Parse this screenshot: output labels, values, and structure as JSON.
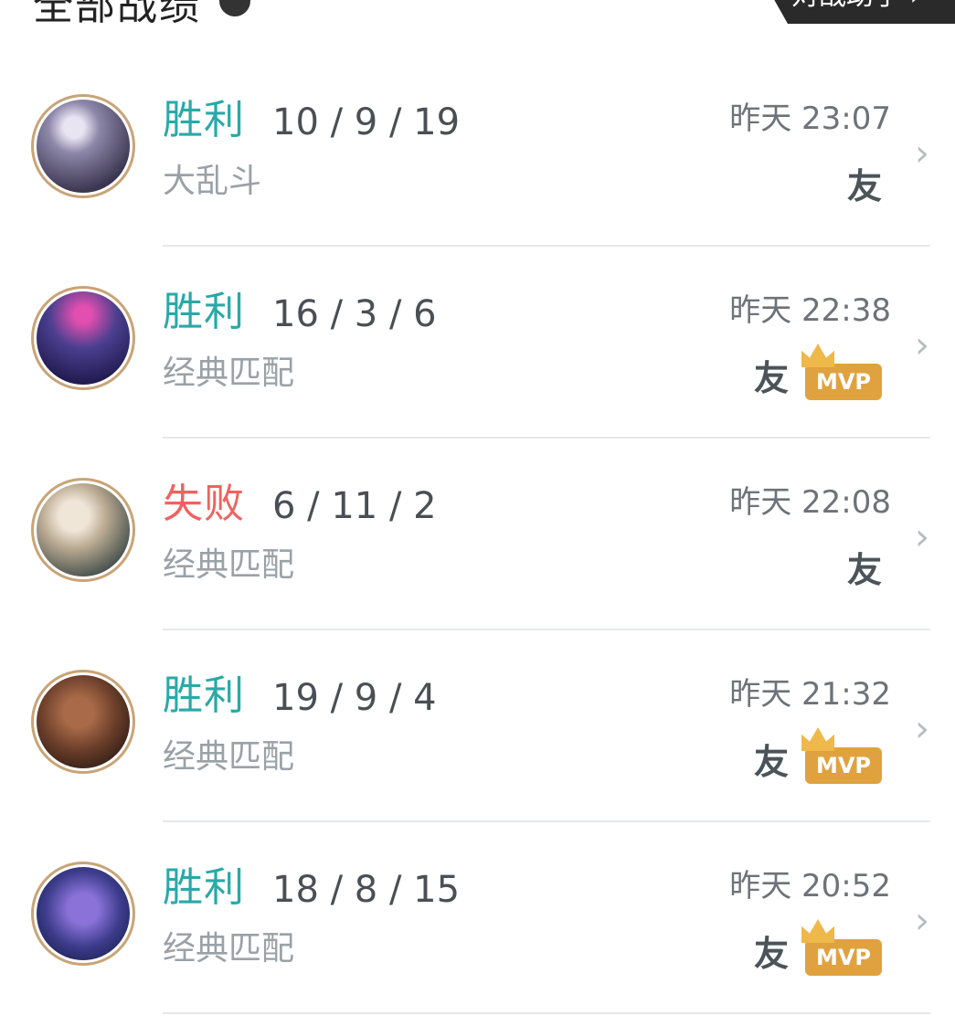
{
  "header": {
    "title": "全部战绩",
    "tab_label": "对战助手 ›"
  },
  "colors": {
    "win": "#27aaa8",
    "loss": "#f0625f"
  },
  "matches": [
    {
      "result": "胜利",
      "outcome": "win",
      "kda": "10 / 9 / 19",
      "mode": "大乱斗",
      "time": "昨天 23:07",
      "friend": "友",
      "mvp": "",
      "avatar_icon": "champion-avatar-diana"
    },
    {
      "result": "胜利",
      "outcome": "win",
      "kda": "16 / 3 / 6",
      "mode": "经典匹配",
      "time": "昨天 22:38",
      "friend": "友",
      "mvp": "MVP",
      "avatar_icon": "champion-avatar-evelynn"
    },
    {
      "result": "失败",
      "outcome": "loss",
      "kda": "6 / 11 / 2",
      "mode": "经典匹配",
      "time": "昨天 22:08",
      "friend": "友",
      "mvp": "",
      "avatar_icon": "champion-avatar-camille"
    },
    {
      "result": "胜利",
      "outcome": "win",
      "kda": "19 / 9 / 4",
      "mode": "经典匹配",
      "time": "昨天 21:32",
      "friend": "友",
      "mvp": "MVP",
      "avatar_icon": "champion-avatar-lucian"
    },
    {
      "result": "胜利",
      "outcome": "win",
      "kda": "18 / 8 / 15",
      "mode": "经典匹配",
      "time": "昨天 20:52",
      "friend": "友",
      "mvp": "MVP",
      "avatar_icon": "champion-avatar-tristana"
    }
  ]
}
